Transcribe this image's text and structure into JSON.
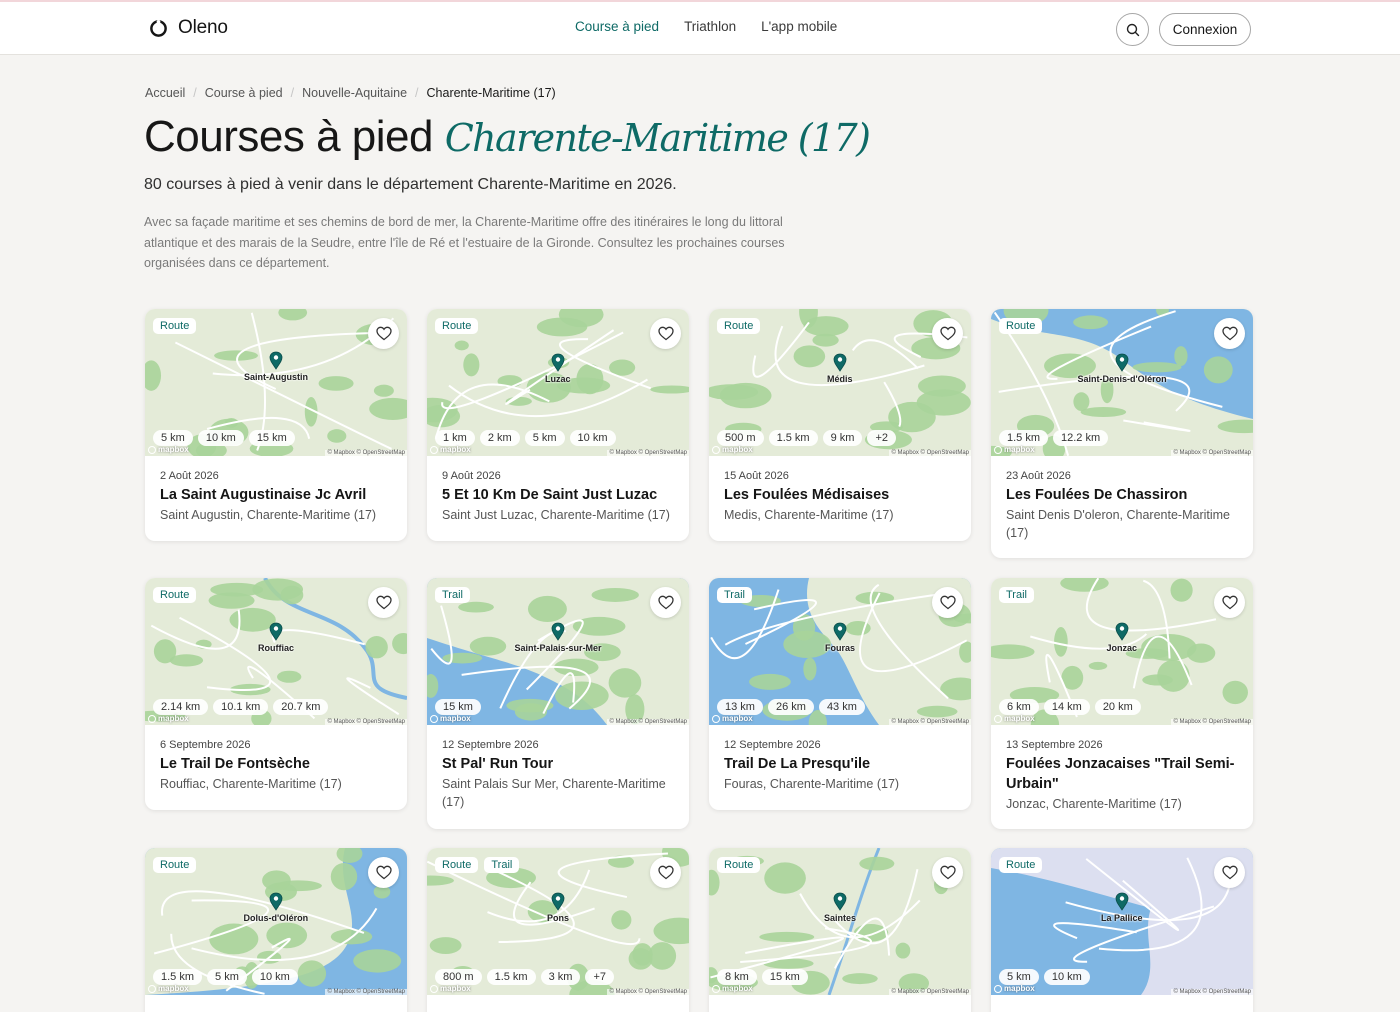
{
  "header": {
    "brand": "Oleno",
    "nav": [
      "Course à pied",
      "Triathlon",
      "L'app mobile"
    ],
    "login_label": "Connexion"
  },
  "breadcrumb": [
    "Accueil",
    "Course à pied",
    "Nouvelle-Aquitaine",
    "Charente-Maritime (17)"
  ],
  "page": {
    "title_main": "Courses à pied",
    "title_accent": "Charente-Maritime (17)",
    "subtitle": "80 courses à pied à venir dans le département Charente-Maritime en 2026.",
    "intro": "Avec sa façade maritime et ses chemins de bord de mer, la Charente-Maritime offre des itinéraires le long du littoral atlantique et des marais de la Seudre, entre l'île de Ré et l'estuaire de la Gironde. Consultez les prochaines courses organisées dans ce département."
  },
  "map_attribution": {
    "brand": "mapbox",
    "credits": "© Mapbox © OpenStreetMap"
  },
  "colors": {
    "accent": "#0e6a66",
    "land": "#e4ebd8",
    "forest": "#a9d49a",
    "water": "#7fb6e3",
    "road": "#ffffff"
  },
  "races": [
    {
      "tags": [
        "Route"
      ],
      "place": "Saint-Augustin",
      "distances": [
        "5 km",
        "10 km",
        "15 km"
      ],
      "date": "2 Août 2026",
      "title": "La Saint Augustinaise Jc Avril",
      "location": "Saint Augustin, Charente-Maritime (17)"
    },
    {
      "tags": [
        "Route"
      ],
      "place": "Luzac",
      "distances": [
        "1 km",
        "2 km",
        "5 km",
        "10 km"
      ],
      "date": "9 Août 2026",
      "title": "5 Et 10 Km De Saint Just Luzac",
      "location": "Saint Just Luzac, Charente-Maritime (17)"
    },
    {
      "tags": [
        "Route"
      ],
      "place": "Médis",
      "distances": [
        "500 m",
        "1.5 km",
        "9 km",
        "+2"
      ],
      "date": "15 Août 2026",
      "title": "Les Foulées Médisaises",
      "location": "Medis, Charente-Maritime (17)"
    },
    {
      "tags": [
        "Route"
      ],
      "place": "Saint-Denis-d'Oléron",
      "distances": [
        "1.5 km",
        "12.2 km"
      ],
      "date": "23 Août 2026",
      "title": "Les Foulées De Chassiron",
      "location": "Saint Denis D'oleron, Charente-Maritime (17)"
    },
    {
      "tags": [
        "Route"
      ],
      "place": "Rouffiac",
      "distances": [
        "2.14 km",
        "10.1 km",
        "20.7 km"
      ],
      "date": "6 Septembre 2026",
      "title": "Le Trail De Fontsèche",
      "location": "Rouffiac, Charente-Maritime (17)"
    },
    {
      "tags": [
        "Trail"
      ],
      "place": "Saint-Palais-sur-Mer",
      "distances": [
        "15 km"
      ],
      "date": "12 Septembre 2026",
      "title": "St Pal' Run Tour",
      "location": "Saint Palais Sur Mer, Charente-Maritime (17)"
    },
    {
      "tags": [
        "Trail"
      ],
      "place": "Fouras",
      "distances": [
        "13 km",
        "26 km",
        "43 km"
      ],
      "date": "12 Septembre 2026",
      "title": "Trail De La Presqu'ile",
      "location": "Fouras, Charente-Maritime (17)"
    },
    {
      "tags": [
        "Trail"
      ],
      "place": "Jonzac",
      "distances": [
        "6 km",
        "14 km",
        "20 km"
      ],
      "date": "13 Septembre 2026",
      "title": "Foulées Jonzacaises \"Trail Semi-Urbain\"",
      "location": "Jonzac, Charente-Maritime (17)"
    },
    {
      "tags": [
        "Route"
      ],
      "place": "Dolus-d'Oléron",
      "distances": [
        "1.5 km",
        "5 km",
        "10 km"
      ]
    },
    {
      "tags": [
        "Route",
        "Trail"
      ],
      "place": "Pons",
      "distances": [
        "800 m",
        "1.5 km",
        "3 km",
        "+7"
      ]
    },
    {
      "tags": [
        "Route"
      ],
      "place": "Saintes",
      "distances": [
        "8 km",
        "15 km"
      ]
    },
    {
      "tags": [
        "Route"
      ],
      "place": "La Pallice",
      "distances": [
        "5 km",
        "10 km"
      ]
    }
  ]
}
